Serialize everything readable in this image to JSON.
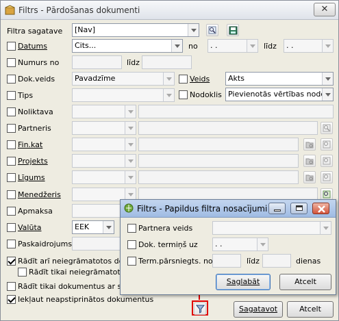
{
  "window": {
    "title": "Filtrs - Pārdošanas dokumenti",
    "close": "✕"
  },
  "rows": {
    "filtra_sagatave": {
      "label": "Filtra sagatave",
      "value": "[Nav]"
    },
    "datums": {
      "label": "Datums",
      "value": "Cits...",
      "no_label": "no",
      "no_value": ". .",
      "lidz_label": "līdz",
      "lidz_value": ". ."
    },
    "numurs": {
      "label": "Numurs no",
      "lidz_label": "līdz"
    },
    "dok_veids": {
      "label": "Dok.veids",
      "value": "Pavadzīme"
    },
    "veids": {
      "label": "Veids",
      "value": "Akts"
    },
    "tips": {
      "label": "Tips"
    },
    "nodoklis": {
      "label": "Nodoklis",
      "value": "Pievienotās vērtības nodoklis"
    },
    "noliktava": {
      "label": "Noliktava"
    },
    "partneris": {
      "label": "Partneris"
    },
    "fin_kat": {
      "label": "Fin.kat"
    },
    "projekts": {
      "label": "Projekts"
    },
    "ligums": {
      "label": "Līgums"
    },
    "menedzeris": {
      "label": "Menedžeris"
    },
    "apmaksa": {
      "label": "Apmaksa"
    },
    "valuta": {
      "label": "Valūta",
      "value": "EEK"
    },
    "paskaidrojums": {
      "label": "Paskaidrojums"
    }
  },
  "checks": {
    "radit_neiegramatotos": "Rādīt arī neiegrāmatotos dokum",
    "radit_tikai_neiegramatotos": "Rādīt tikai neiegrāmatotos d",
    "radit_tikai_stingr": "Rādīt tikai dokumentus ar stingr",
    "ieklaut_neapstiprinatos": "Iekļaut neapstiprinātos dokumentus"
  },
  "buttons": {
    "sagatavot": "Sagatavot",
    "atcelt": "Atcelt"
  },
  "dialog": {
    "title": "Filtrs - Papildus filtra nosacījumi",
    "partnera_veids": "Partnera veids",
    "dok_termins": "Dok. termiņš uz",
    "dok_termins_value": ". .",
    "term_parsniegts": "Term.pārsniegts. no",
    "lidz": "līdz",
    "dienas": "dienas",
    "saglabat": "Saglabāt",
    "atcelt": "Atcelt"
  },
  "colors": {
    "accent_red": "#e00000",
    "dialog_title": "#9fbbe3"
  }
}
